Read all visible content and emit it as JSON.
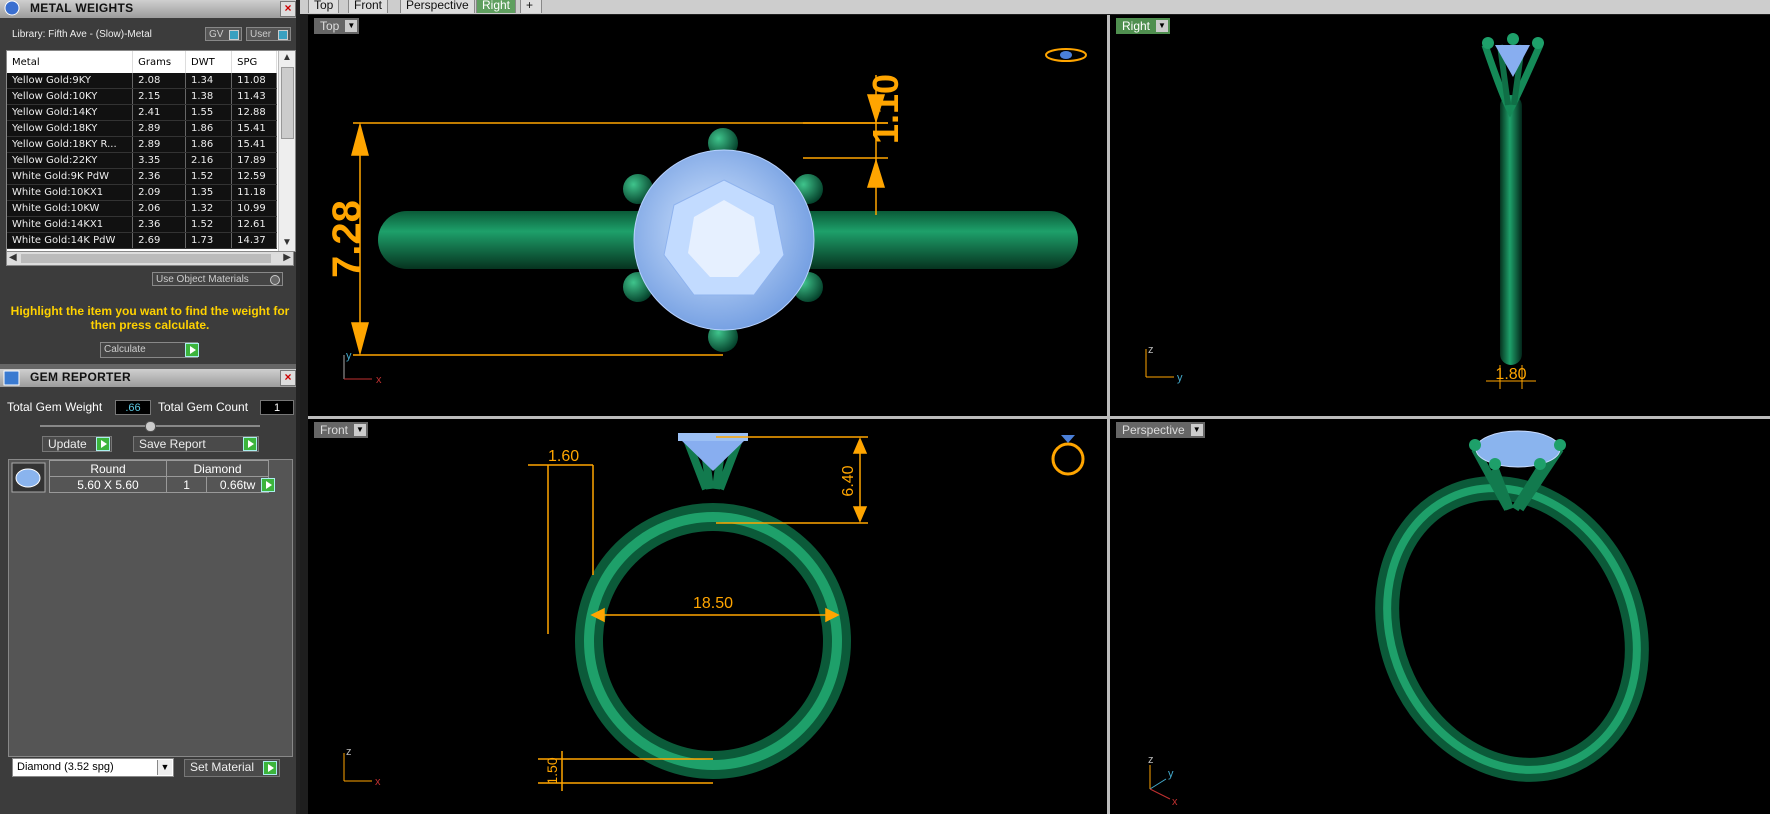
{
  "metal_panel": {
    "title": "METAL WEIGHTS",
    "library": "Library: Fifth Ave - (Slow)-Metal",
    "gv_label": "GV",
    "user_label": "User",
    "columns": [
      "Metal",
      "Grams",
      "DWT",
      "SPG"
    ],
    "rows": [
      [
        "Yellow Gold:9KY",
        "2.08",
        "1.34",
        "11.08"
      ],
      [
        "Yellow Gold:10KY",
        "2.15",
        "1.38",
        "11.43"
      ],
      [
        "Yellow Gold:14KY",
        "2.41",
        "1.55",
        "12.88"
      ],
      [
        "Yellow Gold:18KY",
        "2.89",
        "1.86",
        "15.41"
      ],
      [
        "Yellow Gold:18KY R...",
        "2.89",
        "1.86",
        "15.41"
      ],
      [
        "Yellow Gold:22KY",
        "3.35",
        "2.16",
        "17.89"
      ],
      [
        "White Gold:9K PdW",
        "2.36",
        "1.52",
        "12.59"
      ],
      [
        "White Gold:10KX1",
        "2.09",
        "1.35",
        "11.18"
      ],
      [
        "White Gold:10KW",
        "2.06",
        "1.32",
        "10.99"
      ],
      [
        "White Gold:14KX1",
        "2.36",
        "1.52",
        "12.61"
      ],
      [
        "White Gold:14K PdW",
        "2.69",
        "1.73",
        "14.37"
      ]
    ],
    "use_object_materials": "Use Object Materials",
    "hint": "Highlight the item you want to find the weight for then press calculate.",
    "calculate": "Calculate"
  },
  "gem_panel": {
    "title": "GEM REPORTER",
    "total_weight_label": "Total Gem Weight",
    "total_weight_value": ".66",
    "total_count_label": "Total Gem Count",
    "total_count_value": "1",
    "update": "Update",
    "save_report": "Save Report",
    "gem": {
      "shape": "Round",
      "material": "Diamond",
      "size": "5.60 X 5.60",
      "count": "1",
      "weight": "0.66tw"
    },
    "material_select": "Diamond     (3.52 spg)",
    "set_material": "Set Material"
  },
  "tabs": [
    "Top",
    "Front",
    "Perspective",
    "Right"
  ],
  "active_tab": "Right",
  "viewports": {
    "top": {
      "label": "Top",
      "dims": [
        "7.28",
        "1.10"
      ],
      "axis": [
        "y",
        "x"
      ]
    },
    "right": {
      "label": "Right",
      "dims": [
        "1.80"
      ],
      "axis": [
        "z",
        "y"
      ]
    },
    "front": {
      "label": "Front",
      "dims": [
        "1.60",
        "6.40",
        "18.50",
        "1.50"
      ],
      "axis": [
        "z",
        "x"
      ]
    },
    "perspective": {
      "label": "Perspective",
      "axis": [
        "z",
        "y",
        "x"
      ]
    }
  },
  "colors": {
    "metal": "#127a4e",
    "stone": "#9cc0f4",
    "dimension": "#ffa500",
    "hint": "#ffd200"
  }
}
